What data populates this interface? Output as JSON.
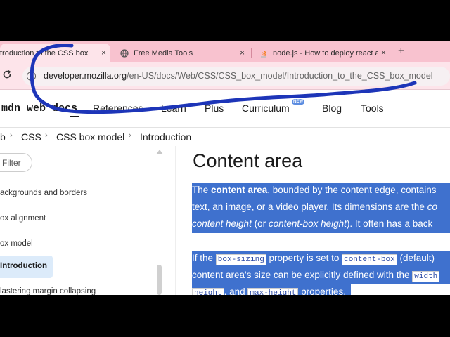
{
  "tabs": [
    {
      "label": "troduction to the CSS box mo",
      "close": "×",
      "favicon": "mdn-favicon"
    },
    {
      "label": "Free Media Tools",
      "close": "×",
      "favicon": "globe-icon"
    },
    {
      "label": "node.js - How to deploy react a",
      "close": "×",
      "favicon": "stackoverflow-icon"
    }
  ],
  "newtab_label": "+",
  "toolbar": {
    "reload_icon": "reload-icon",
    "url_host": "developer.mozilla.org",
    "url_path": "/en-US/docs/Web/CSS/CSS_box_model/Introduction_to_the_CSS_box_model"
  },
  "mdn": {
    "logo": "mdn web docs",
    "nav": [
      "References",
      "Learn",
      "Plus",
      "Curriculum",
      "Blog",
      "Tools"
    ],
    "new_badge": "NEW"
  },
  "breadcrumbs": [
    "b",
    "CSS",
    "CSS box model",
    "Introduction"
  ],
  "sidebar": {
    "filter_placeholder": "Filter",
    "items": [
      "ackgrounds and borders",
      "ox alignment",
      "ox model",
      "Introduction",
      "lastering margin collapsing"
    ]
  },
  "content": {
    "heading": "Content area",
    "line1_a": "The ",
    "line1_b": "content area",
    "line1_c": ", bounded by the content edge, contains",
    "line2_a": "text, an image, or a video player. Its dimensions are the ",
    "line2_b": "co",
    "line3_a": "content height",
    "line3_b": " (or ",
    "line3_c": "content-box height",
    "line3_d": "). It often has a back",
    "line4_a": "If the ",
    "line4_code1": "box-sizing",
    "line4_b": " property is set to ",
    "line4_code2": "content-box",
    "line4_c": " (default)",
    "line5_a": "content area's size can be explicitly defined with the ",
    "line5_code": "width",
    "line6_code1": "height",
    "line6_a": ", and ",
    "line6_code2": "max-height",
    "line6_b": " properties."
  },
  "colors": {
    "tab_bar": "#f8c2cf",
    "selection": "#3f71ce",
    "annotation": "#1d35b8"
  }
}
